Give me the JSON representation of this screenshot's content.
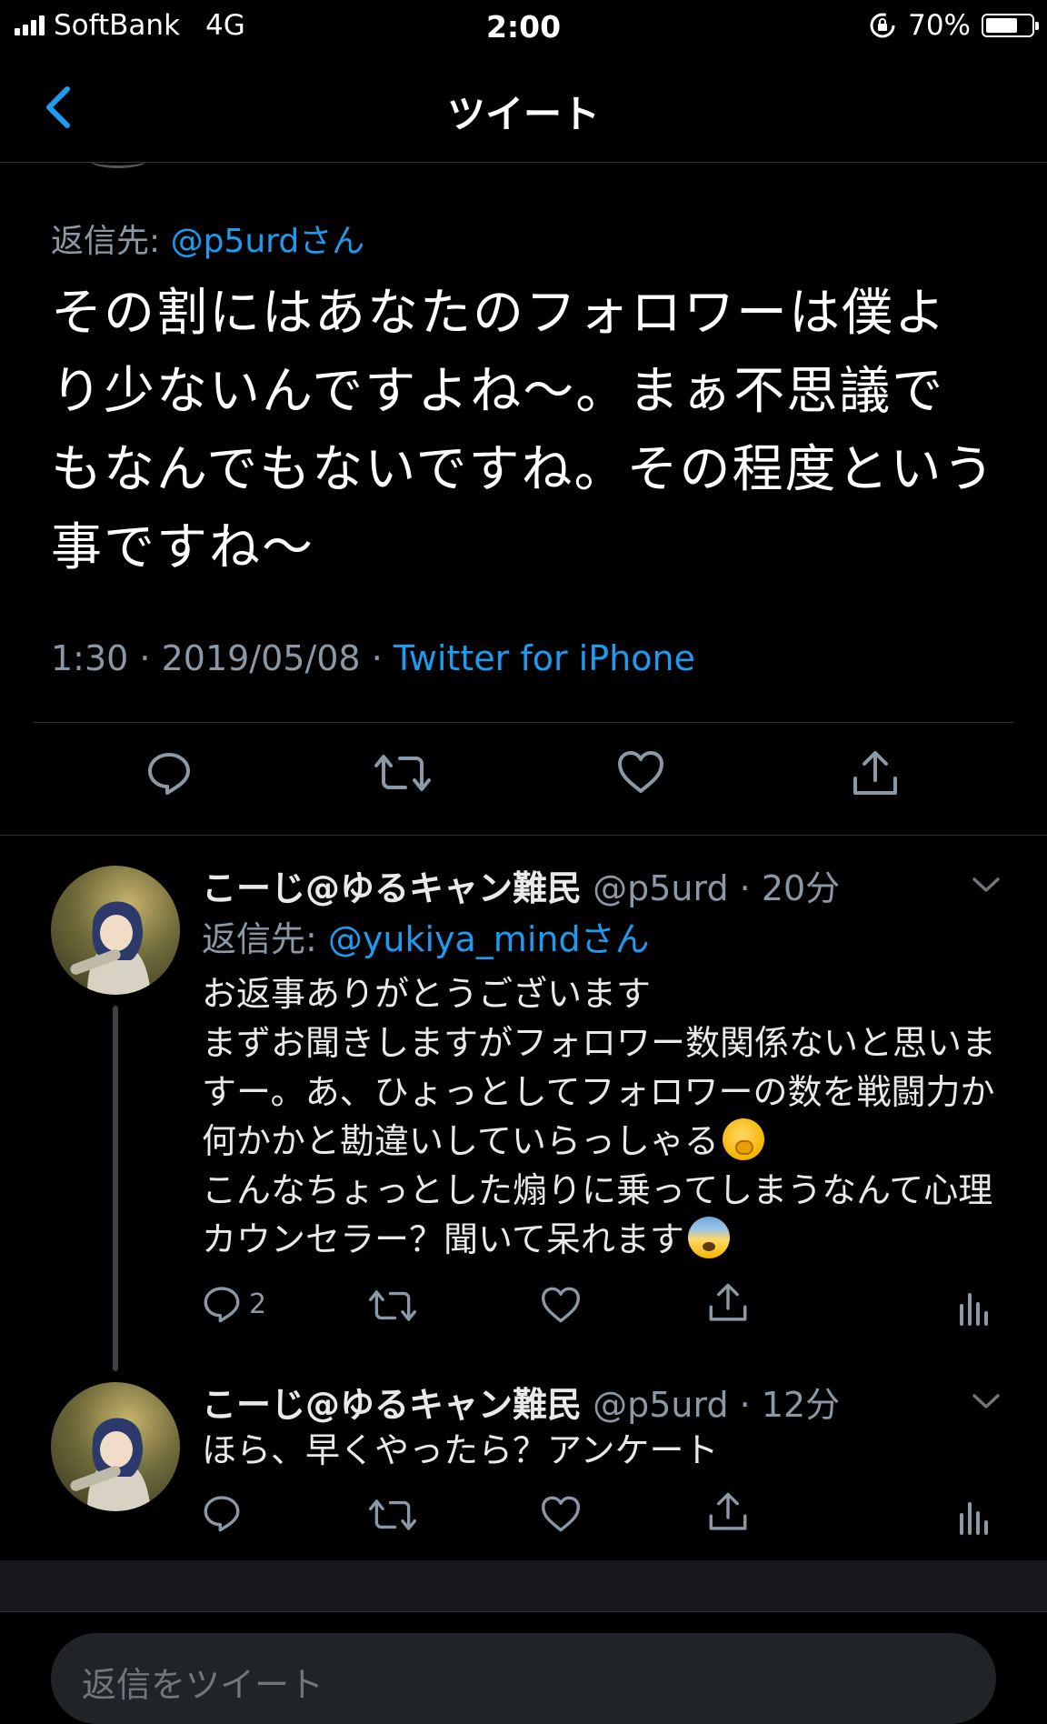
{
  "status_bar": {
    "carrier": "SoftBank",
    "network": "4G",
    "time": "2:00",
    "battery": "70%",
    "battery_level": 0.7
  },
  "nav": {
    "title": "ツイート",
    "back_icon": "chevron-left-icon"
  },
  "main_tweet": {
    "reply_label": "返信先: ",
    "reply_to": "@p5urdさん",
    "text": "その割にはあなたのフォロワーは僕より少ないんですよね〜。まぁ不思議でもなんでもないですね。その程度という事ですね〜",
    "time": "1:30",
    "date": "2019/05/08",
    "separator": " · ",
    "source": "Twitter for iPhone"
  },
  "replies": [
    {
      "name": "こーじ@ゆるキャン難民",
      "handle": "@p5urd",
      "age": "20分",
      "reply_label": "返信先: ",
      "reply_to": "@yukiya_mindさん",
      "text": "お返事ありがとうございます\nまずお聞きしますがフォロワー数関係ないと思いますー。あ、ひょっとしてフォロワーの数を戦闘力か何かかと勘違いしていらっしゃる",
      "emoji1": "face-with-hand-over-mouth",
      "text2": "\nこんなちょっとした煽りに乗ってしまうなんて心理カウンセラー？聞いて呆れます",
      "emoji2": "fearful-face",
      "reply_count": "2"
    },
    {
      "name": "こーじ@ゆるキャン難民",
      "handle": "@p5urd",
      "age": "12分",
      "text": "ほら、早くやったら？アンケート"
    }
  ],
  "compose": {
    "placeholder": "返信をツイート"
  },
  "colors": {
    "background": "#000000",
    "link": "#1d9bf0",
    "muted": "#8b98a5"
  }
}
